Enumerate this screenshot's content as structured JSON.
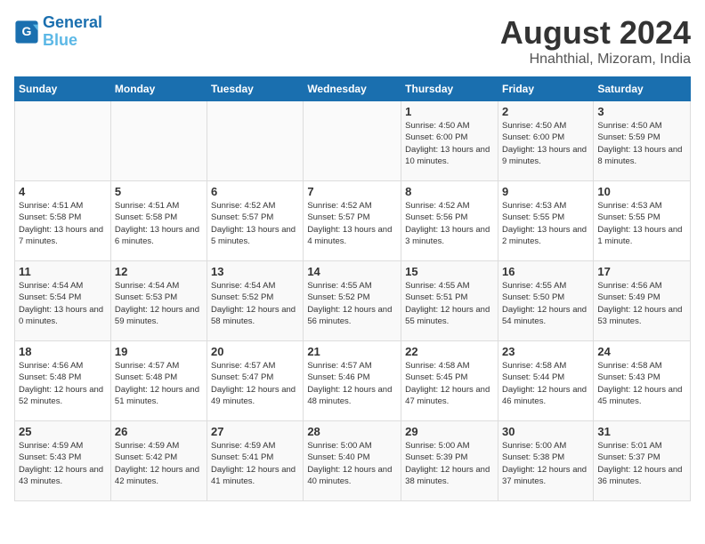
{
  "logo": {
    "line1": "General",
    "line2": "Blue"
  },
  "title": "August 2024",
  "subtitle": "Hnahthial, Mizoram, India",
  "days_of_week": [
    "Sunday",
    "Monday",
    "Tuesday",
    "Wednesday",
    "Thursday",
    "Friday",
    "Saturday"
  ],
  "weeks": [
    [
      {
        "day": "",
        "info": ""
      },
      {
        "day": "",
        "info": ""
      },
      {
        "day": "",
        "info": ""
      },
      {
        "day": "",
        "info": ""
      },
      {
        "day": "1",
        "sunrise": "4:50 AM",
        "sunset": "6:00 PM",
        "daylight": "13 hours and 10 minutes."
      },
      {
        "day": "2",
        "sunrise": "4:50 AM",
        "sunset": "6:00 PM",
        "daylight": "13 hours and 9 minutes."
      },
      {
        "day": "3",
        "sunrise": "4:50 AM",
        "sunset": "5:59 PM",
        "daylight": "13 hours and 8 minutes."
      }
    ],
    [
      {
        "day": "4",
        "sunrise": "4:51 AM",
        "sunset": "5:58 PM",
        "daylight": "13 hours and 7 minutes."
      },
      {
        "day": "5",
        "sunrise": "4:51 AM",
        "sunset": "5:58 PM",
        "daylight": "13 hours and 6 minutes."
      },
      {
        "day": "6",
        "sunrise": "4:52 AM",
        "sunset": "5:57 PM",
        "daylight": "13 hours and 5 minutes."
      },
      {
        "day": "7",
        "sunrise": "4:52 AM",
        "sunset": "5:57 PM",
        "daylight": "13 hours and 4 minutes."
      },
      {
        "day": "8",
        "sunrise": "4:52 AM",
        "sunset": "5:56 PM",
        "daylight": "13 hours and 3 minutes."
      },
      {
        "day": "9",
        "sunrise": "4:53 AM",
        "sunset": "5:55 PM",
        "daylight": "13 hours and 2 minutes."
      },
      {
        "day": "10",
        "sunrise": "4:53 AM",
        "sunset": "5:55 PM",
        "daylight": "13 hours and 1 minute."
      }
    ],
    [
      {
        "day": "11",
        "sunrise": "4:54 AM",
        "sunset": "5:54 PM",
        "daylight": "13 hours and 0 minutes."
      },
      {
        "day": "12",
        "sunrise": "4:54 AM",
        "sunset": "5:53 PM",
        "daylight": "12 hours and 59 minutes."
      },
      {
        "day": "13",
        "sunrise": "4:54 AM",
        "sunset": "5:52 PM",
        "daylight": "12 hours and 58 minutes."
      },
      {
        "day": "14",
        "sunrise": "4:55 AM",
        "sunset": "5:52 PM",
        "daylight": "12 hours and 56 minutes."
      },
      {
        "day": "15",
        "sunrise": "4:55 AM",
        "sunset": "5:51 PM",
        "daylight": "12 hours and 55 minutes."
      },
      {
        "day": "16",
        "sunrise": "4:55 AM",
        "sunset": "5:50 PM",
        "daylight": "12 hours and 54 minutes."
      },
      {
        "day": "17",
        "sunrise": "4:56 AM",
        "sunset": "5:49 PM",
        "daylight": "12 hours and 53 minutes."
      }
    ],
    [
      {
        "day": "18",
        "sunrise": "4:56 AM",
        "sunset": "5:48 PM",
        "daylight": "12 hours and 52 minutes."
      },
      {
        "day": "19",
        "sunrise": "4:57 AM",
        "sunset": "5:48 PM",
        "daylight": "12 hours and 51 minutes."
      },
      {
        "day": "20",
        "sunrise": "4:57 AM",
        "sunset": "5:47 PM",
        "daylight": "12 hours and 49 minutes."
      },
      {
        "day": "21",
        "sunrise": "4:57 AM",
        "sunset": "5:46 PM",
        "daylight": "12 hours and 48 minutes."
      },
      {
        "day": "22",
        "sunrise": "4:58 AM",
        "sunset": "5:45 PM",
        "daylight": "12 hours and 47 minutes."
      },
      {
        "day": "23",
        "sunrise": "4:58 AM",
        "sunset": "5:44 PM",
        "daylight": "12 hours and 46 minutes."
      },
      {
        "day": "24",
        "sunrise": "4:58 AM",
        "sunset": "5:43 PM",
        "daylight": "12 hours and 45 minutes."
      }
    ],
    [
      {
        "day": "25",
        "sunrise": "4:59 AM",
        "sunset": "5:43 PM",
        "daylight": "12 hours and 43 minutes."
      },
      {
        "day": "26",
        "sunrise": "4:59 AM",
        "sunset": "5:42 PM",
        "daylight": "12 hours and 42 minutes."
      },
      {
        "day": "27",
        "sunrise": "4:59 AM",
        "sunset": "5:41 PM",
        "daylight": "12 hours and 41 minutes."
      },
      {
        "day": "28",
        "sunrise": "5:00 AM",
        "sunset": "5:40 PM",
        "daylight": "12 hours and 40 minutes."
      },
      {
        "day": "29",
        "sunrise": "5:00 AM",
        "sunset": "5:39 PM",
        "daylight": "12 hours and 38 minutes."
      },
      {
        "day": "30",
        "sunrise": "5:00 AM",
        "sunset": "5:38 PM",
        "daylight": "12 hours and 37 minutes."
      },
      {
        "day": "31",
        "sunrise": "5:01 AM",
        "sunset": "5:37 PM",
        "daylight": "12 hours and 36 minutes."
      }
    ]
  ]
}
